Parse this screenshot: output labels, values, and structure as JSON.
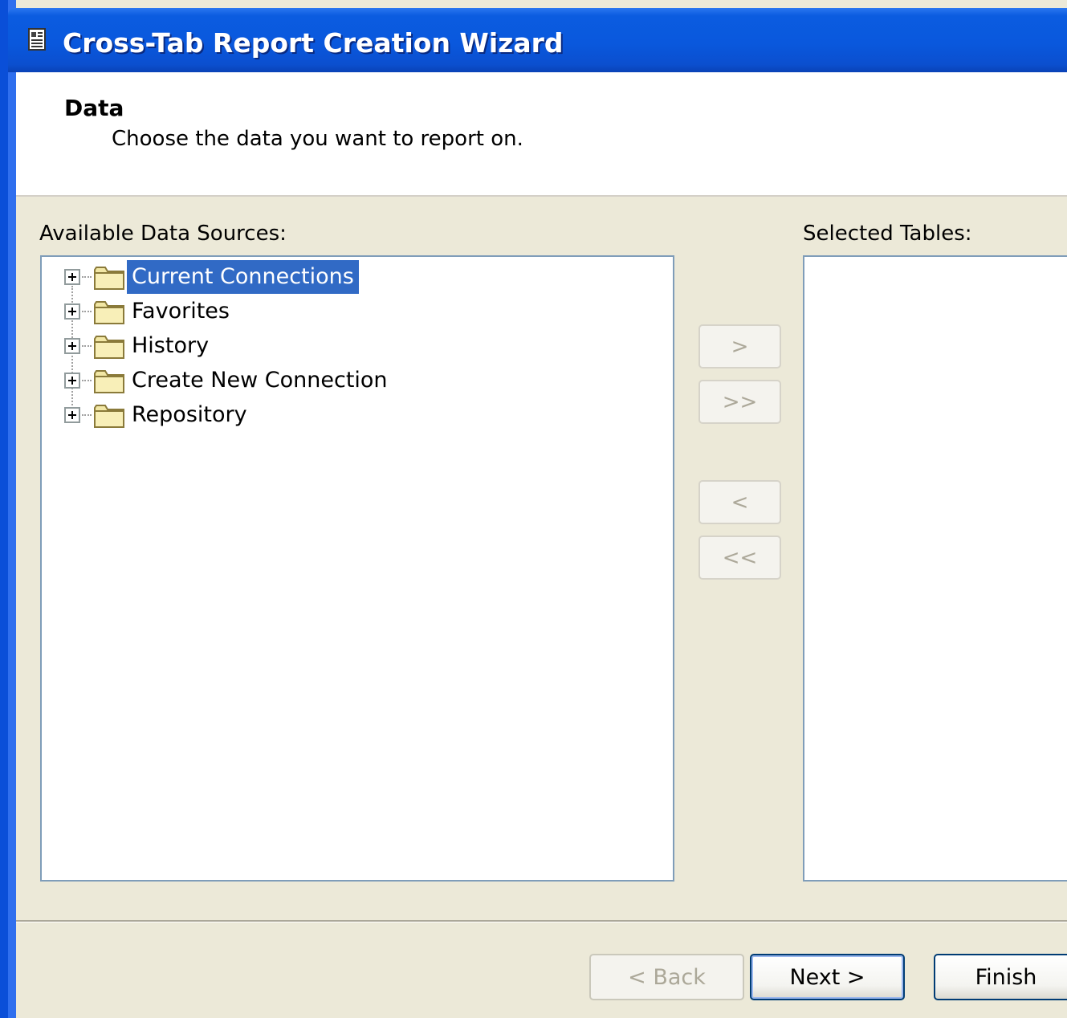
{
  "window": {
    "title": "Cross-Tab Report Creation Wizard"
  },
  "header": {
    "title": "Data",
    "subtitle": "Choose the data you want to report on."
  },
  "available": {
    "label": "Available Data Sources:",
    "items": [
      {
        "label": "Current Connections",
        "selected": true
      },
      {
        "label": "Favorites",
        "selected": false
      },
      {
        "label": "History",
        "selected": false
      },
      {
        "label": "Create New Connection",
        "selected": false
      },
      {
        "label": "Repository",
        "selected": false
      }
    ]
  },
  "selected": {
    "label": "Selected Tables:"
  },
  "move_buttons": {
    "add": ">",
    "add_all": ">>",
    "remove": "<",
    "remove_all": "<<"
  },
  "footer": {
    "back": "< Back",
    "next": "Next >",
    "finish": "Finish"
  },
  "colors": {
    "titlebar": "#0a58dd",
    "selection": "#316ac5",
    "dialog_bg": "#ece9d8"
  }
}
